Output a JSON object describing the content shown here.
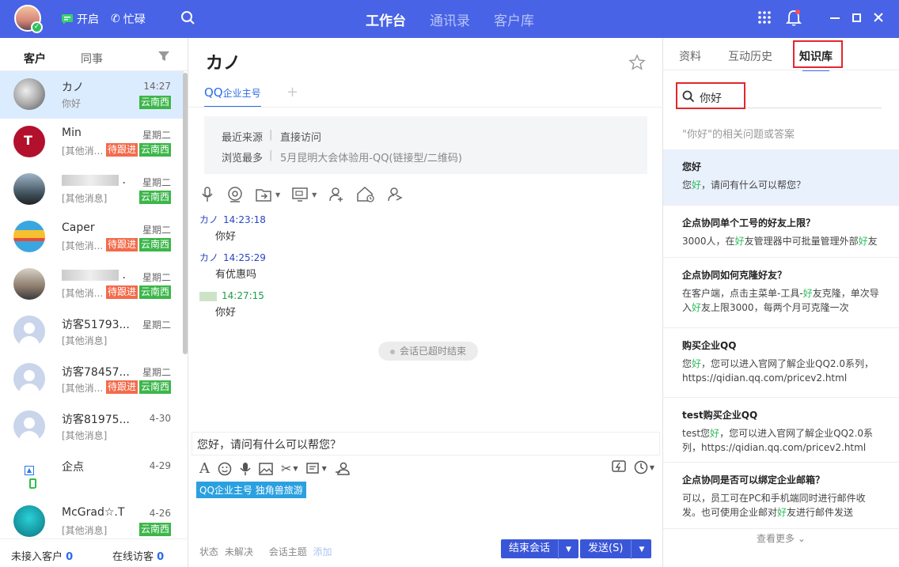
{
  "header": {
    "status_open": "开启",
    "status_busy": "忙碌",
    "nav": [
      "工作台",
      "通讯录",
      "客户库"
    ],
    "accent": "#4863e6"
  },
  "left": {
    "tabs": [
      "客户",
      "同事"
    ],
    "contacts": [
      {
        "name": "カノ",
        "msg": "你好",
        "time": "14:27",
        "tags": [
          {
            "t": "云南西",
            "c": "green"
          }
        ],
        "selected": true,
        "av": "photo"
      },
      {
        "name": "Min",
        "msg": "[其他消...",
        "time": "星期二",
        "tags": [
          {
            "t": "待跟进",
            "c": "orange"
          },
          {
            "t": "云南西",
            "c": "green"
          }
        ],
        "av": "tmobile"
      },
      {
        "name": "",
        "blur": true,
        "msg": "[其他消息]",
        "time": "星期二",
        "tags": [
          {
            "t": "云南西",
            "c": "green"
          }
        ],
        "av": "photo2"
      },
      {
        "name": "Caper",
        "msg": "[其他消...",
        "time": "星期二",
        "tags": [
          {
            "t": "待跟进",
            "c": "orange"
          },
          {
            "t": "云南西",
            "c": "green"
          }
        ],
        "av": "beach"
      },
      {
        "name": "",
        "blur": true,
        "msg": "[其他消...",
        "time": "星期二",
        "tags": [
          {
            "t": "待跟进",
            "c": "orange"
          },
          {
            "t": "云南西",
            "c": "green"
          }
        ],
        "av": "photo3"
      },
      {
        "name": "访客51793...",
        "msg": "[其他消息]",
        "time": "星期二",
        "tags": [],
        "av": "default"
      },
      {
        "name": "访客78457...",
        "msg": "[其他消...",
        "time": "星期二",
        "tags": [
          {
            "t": "待跟进",
            "c": "orange"
          },
          {
            "t": "云南西",
            "c": "green"
          }
        ],
        "av": "default"
      },
      {
        "name": "访客81975...",
        "msg": "[其他消息]",
        "time": "4-30",
        "tags": [],
        "av": "default"
      },
      {
        "name": "企点",
        "msg": "",
        "time": "4-29",
        "tags": [],
        "av": "qidian"
      },
      {
        "name": "McGrad☆.T",
        "msg": "[其他消息]",
        "time": "4-26",
        "tags": [
          {
            "t": "云南西",
            "c": "green"
          }
        ],
        "av": "diver"
      }
    ],
    "footer": {
      "unaccepted_label": "未接入客户",
      "unaccepted_count": "0",
      "online_label": "在线访客",
      "online_count": "0"
    }
  },
  "chat": {
    "title": "カノ",
    "tab_main": "QQ",
    "tab_sub": "企业主号",
    "info": {
      "source_label": "最近来源",
      "source_value": "直接访问",
      "browse_label": "浏览最多",
      "browse_value": "5月昆明大会体验用-QQ(链接型/二维码)"
    },
    "messages": [
      {
        "sender": "カノ",
        "time": "14:23:18",
        "text": "你好",
        "color": "#2b45c4"
      },
      {
        "sender": "カノ",
        "time": "14:25:29",
        "text": "有优惠吗",
        "color": "#2b45c4"
      },
      {
        "sender": "",
        "time": "14:27:15",
        "text": "你好",
        "color": "#1e9e47"
      }
    ],
    "system_msg": "会话已超时结束",
    "input_text": "您好，请问有什么可以帮您？",
    "account_pill": "QQ企业主号 独角兽旅游",
    "footer": {
      "status_label": "状态",
      "status_value": "未解决",
      "topic_label": "会话主题",
      "topic_value": "添加"
    },
    "end_button": "结束会话",
    "send_button": "发送(S)"
  },
  "kb": {
    "tabs": [
      "资料",
      "互动历史",
      "知识库"
    ],
    "search_value": "你好",
    "hint": "\"你好\"的相关问题或答案",
    "items": [
      {
        "q": "您好",
        "a_parts": [
          "您",
          "好",
          "，请问有什么可以帮您？"
        ]
      },
      {
        "q": "企点协同单个工号的好友上限？",
        "a_parts": [
          "3000人，在",
          "好",
          "友管理器中可批量管理外部",
          "好",
          "友"
        ]
      },
      {
        "q": "企点协同如何克隆好友？",
        "a_parts": [
          "在客户端，点击主菜单-工具-",
          "好",
          "友克隆，单次导入",
          "好",
          "友上限3000，每两个月可克隆一次"
        ]
      },
      {
        "q": "购买企业QQ",
        "a_parts": [
          "您",
          "好",
          "，您可以进入官网了解企业QQ2.0系列，https://qidian.qq.com/pricev2.html"
        ]
      },
      {
        "q": "test购买企业QQ",
        "a_parts": [
          "test您",
          "好",
          "，您可以进入官网了解企业QQ2.0系列，https://qidian.qq.com/pricev2.html"
        ]
      },
      {
        "q": "企点协同是否可以绑定企业邮箱？",
        "a_parts": [
          "可以，员工可在PC和手机端同时进行邮件收发。也可使用企业邮对",
          "好",
          "友进行邮件发送"
        ]
      }
    ],
    "more": "查看更多"
  }
}
